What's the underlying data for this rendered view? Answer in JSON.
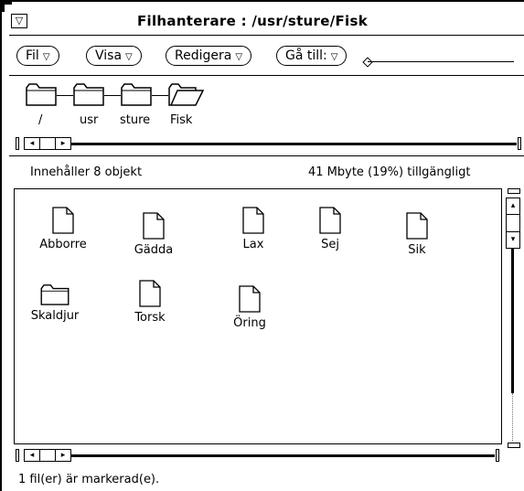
{
  "window": {
    "title": "Filhanterare : /usr/sture/Fisk",
    "menu_glyph": "▽"
  },
  "menus": [
    {
      "label": "Fil"
    },
    {
      "label": "Visa"
    },
    {
      "label": "Redigera"
    },
    {
      "label": "Gå till:"
    }
  ],
  "path": [
    {
      "label": "/",
      "icon": "folder-icon"
    },
    {
      "label": "usr",
      "icon": "folder-icon"
    },
    {
      "label": "sture",
      "icon": "folder-icon"
    },
    {
      "label": "Fisk",
      "icon": "open-folder-icon"
    }
  ],
  "status": {
    "count": "Innehåller 8 objekt",
    "space": "41 Mbyte (19%) tillgängligt"
  },
  "files": [
    {
      "name": "Abborre",
      "icon": "document-icon"
    },
    {
      "name": "Gädda",
      "icon": "document-icon"
    },
    {
      "name": "Lax",
      "icon": "document-icon"
    },
    {
      "name": "Sej",
      "icon": "document-icon"
    },
    {
      "name": "Sik",
      "icon": "document-icon"
    },
    {
      "name": "Skaldjur",
      "icon": "folder-icon"
    },
    {
      "name": "Torsk",
      "icon": "document-icon"
    },
    {
      "name": "Öring",
      "icon": "document-icon"
    }
  ],
  "scroll": {
    "left_arrow": "◂",
    "right_arrow": "▸",
    "up_arrow": "▴",
    "down_arrow": "▾"
  },
  "footer": {
    "message": "1 fil(er) är markerad(e)."
  }
}
